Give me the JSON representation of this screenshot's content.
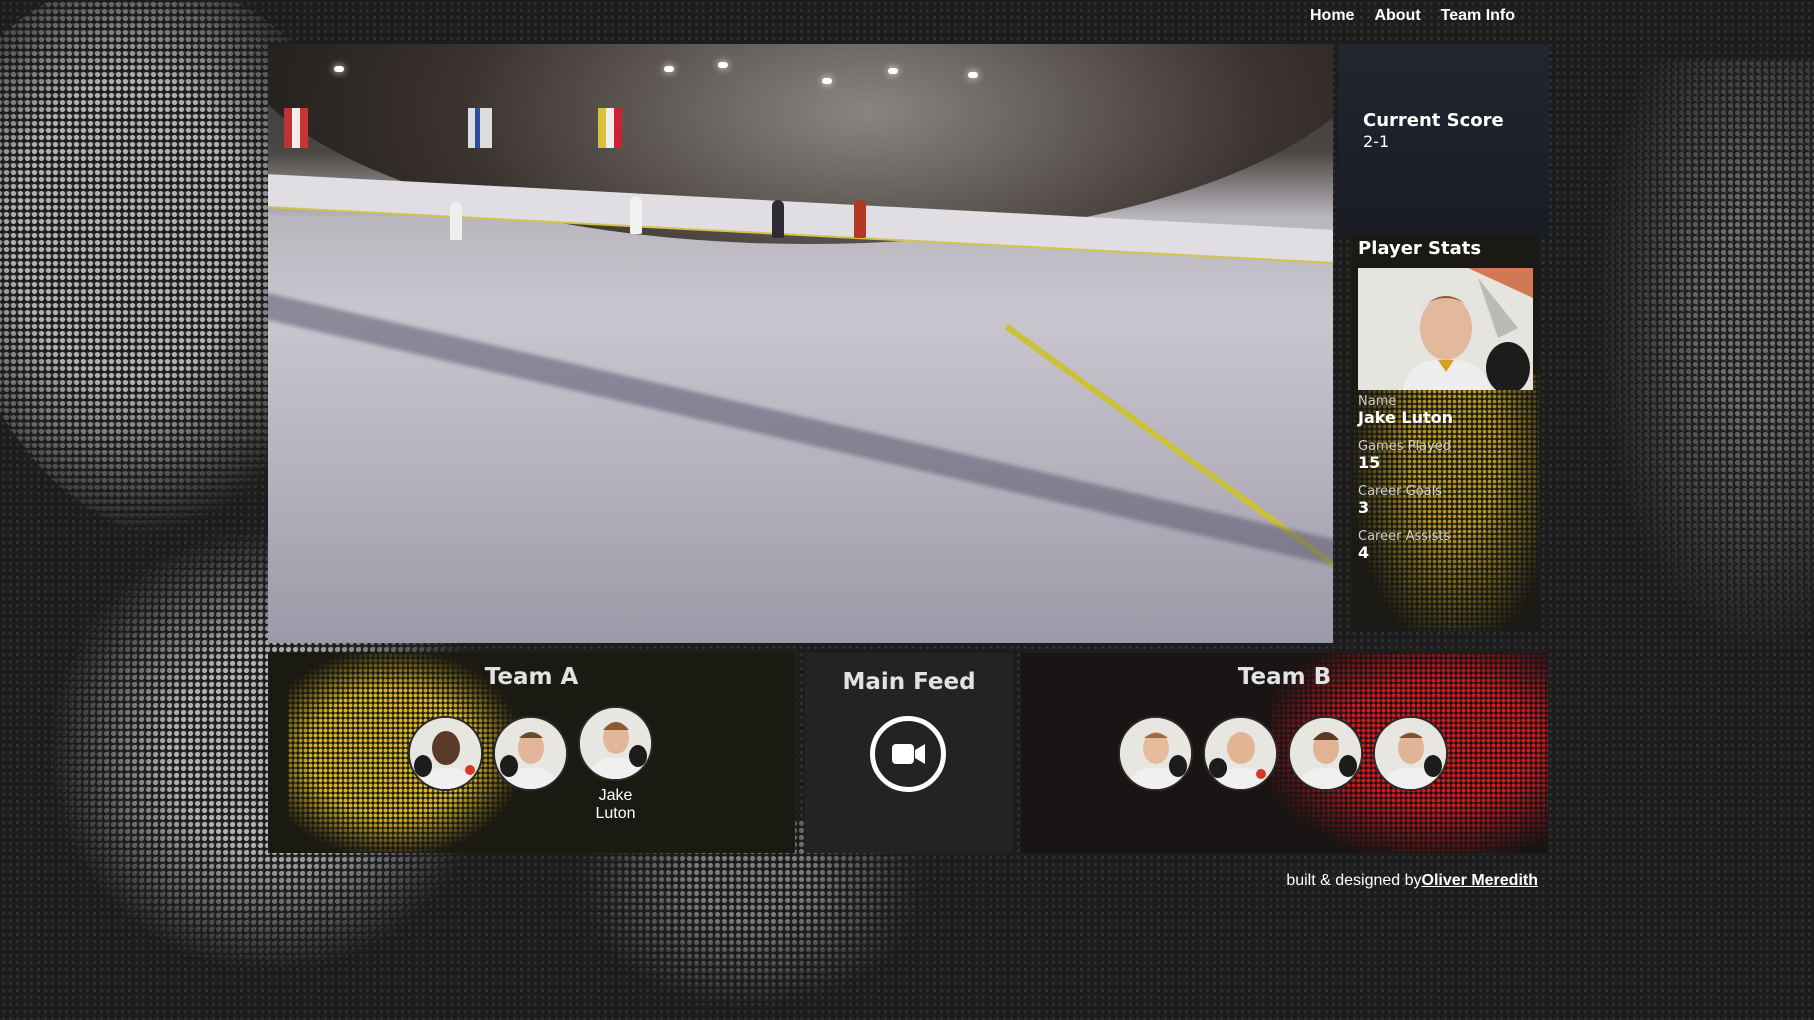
{
  "nav": {
    "items": [
      "Home",
      "About",
      "Team Info"
    ]
  },
  "score": {
    "title": "Current Score",
    "value": "2-1"
  },
  "player_stats": {
    "title": "Player Stats",
    "fields": [
      {
        "label": "Name",
        "value": "Jake Luton"
      },
      {
        "label": "Games Played",
        "value": "15"
      },
      {
        "label": "Career Goals",
        "value": "3"
      },
      {
        "label": "Career Assists",
        "value": "4"
      }
    ]
  },
  "team_a": {
    "title": "Team A",
    "selected_player_name": "Jake Luton",
    "player_count": 3
  },
  "main_feed": {
    "title": "Main Feed",
    "icon": "video-camera-icon"
  },
  "team_b": {
    "title": "Team B",
    "player_count": 4
  },
  "footer": {
    "text": "built & designed by",
    "author": "Oliver Meredith"
  },
  "colors": {
    "team_a_accent": "#d8b62a",
    "team_b_accent": "#d81e24",
    "background": "#1d1d1d"
  }
}
